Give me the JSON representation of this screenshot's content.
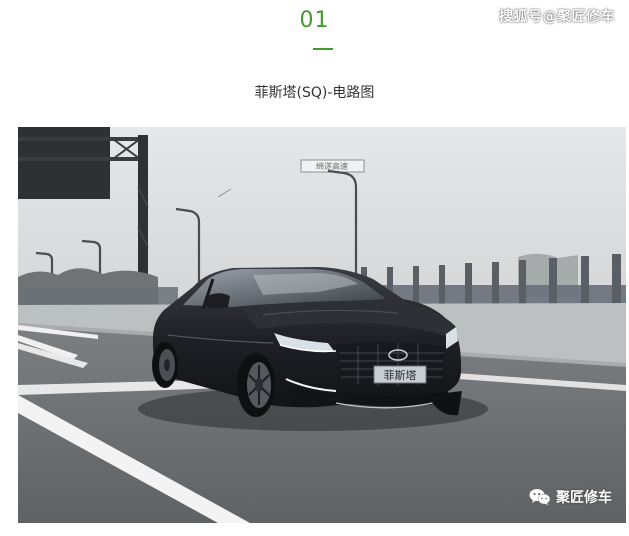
{
  "article": {
    "section_number": "01",
    "caption": "菲斯塔(SQ)-电路图",
    "source_watermark": "搜狐号@聚匠修车"
  },
  "photo": {
    "plate_text": "菲斯塔",
    "overhead_sign_text": "绵遂高速",
    "watermark_label": "聚匠修车"
  },
  "colors": {
    "accent": "#3f9d2c",
    "caption_text": "#333333",
    "car_body": "#1f2126"
  },
  "icons": {
    "watermark_icon": "wechat-icon"
  }
}
